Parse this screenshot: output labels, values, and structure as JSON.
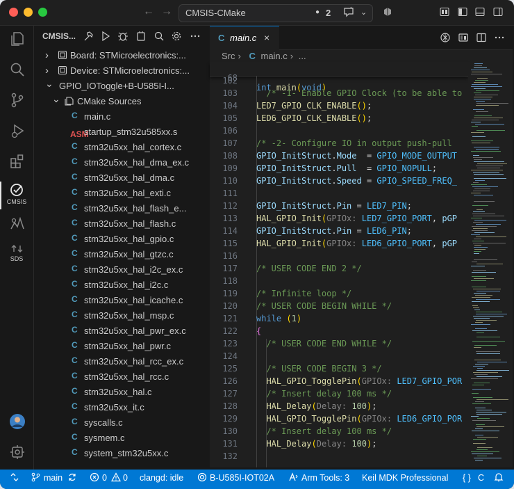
{
  "titlebar": {
    "command_center_title": "CMSIS-CMake",
    "changes_count": "2"
  },
  "activity_bar": {
    "items": [
      {
        "name": "explorer-icon"
      },
      {
        "name": "search-icon"
      },
      {
        "name": "source-control-icon"
      },
      {
        "name": "run-debug-icon"
      },
      {
        "name": "extensions-icon"
      },
      {
        "name": "cmsis-icon",
        "label": "CMSIS"
      },
      {
        "name": "arm-tools-icon"
      },
      {
        "name": "sds-icon",
        "label": "SDS"
      }
    ],
    "cmsis_label": "CMSIS",
    "sds_label": "SDS"
  },
  "sidebar": {
    "title": "CMSIS...",
    "tree": [
      {
        "label": "Board: STMicroelectronics:...",
        "icon": "board-icon",
        "expanded": false,
        "level": 0
      },
      {
        "label": "Device: STMicroelectronics:...",
        "icon": "device-icon",
        "expanded": false,
        "level": 0
      },
      {
        "label": "GPIO_IOToggle+B-U585I-I...",
        "icon": "project-icon",
        "expanded": true,
        "level": 0
      },
      {
        "label": "CMake Sources",
        "icon": "folder-icon",
        "expanded": true,
        "level": 1
      },
      {
        "label": "main.c",
        "icon": "c",
        "level": 2
      },
      {
        "label": "startup_stm32u585xx.s",
        "icon": "asm",
        "level": 2
      },
      {
        "label": "stm32u5xx_hal_cortex.c",
        "icon": "c",
        "level": 2
      },
      {
        "label": "stm32u5xx_hal_dma_ex.c",
        "icon": "c",
        "level": 2
      },
      {
        "label": "stm32u5xx_hal_dma.c",
        "icon": "c",
        "level": 2
      },
      {
        "label": "stm32u5xx_hal_exti.c",
        "icon": "c",
        "level": 2
      },
      {
        "label": "stm32u5xx_hal_flash_e...",
        "icon": "c",
        "level": 2
      },
      {
        "label": "stm32u5xx_hal_flash.c",
        "icon": "c",
        "level": 2
      },
      {
        "label": "stm32u5xx_hal_gpio.c",
        "icon": "c",
        "level": 2
      },
      {
        "label": "stm32u5xx_hal_gtzc.c",
        "icon": "c",
        "level": 2
      },
      {
        "label": "stm32u5xx_hal_i2c_ex.c",
        "icon": "c",
        "level": 2
      },
      {
        "label": "stm32u5xx_hal_i2c.c",
        "icon": "c",
        "level": 2
      },
      {
        "label": "stm32u5xx_hal_icache.c",
        "icon": "c",
        "level": 2
      },
      {
        "label": "stm32u5xx_hal_msp.c",
        "icon": "c",
        "level": 2
      },
      {
        "label": "stm32u5xx_hal_pwr_ex.c",
        "icon": "c",
        "level": 2
      },
      {
        "label": "stm32u5xx_hal_pwr.c",
        "icon": "c",
        "level": 2
      },
      {
        "label": "stm32u5xx_hal_rcc_ex.c",
        "icon": "c",
        "level": 2
      },
      {
        "label": "stm32u5xx_hal_rcc.c",
        "icon": "c",
        "level": 2
      },
      {
        "label": "stm32u5xx_hal.c",
        "icon": "c",
        "level": 2
      },
      {
        "label": "stm32u5xx_it.c",
        "icon": "c",
        "level": 2
      },
      {
        "label": "syscalls.c",
        "icon": "c",
        "level": 2
      },
      {
        "label": "sysmem.c",
        "icon": "c",
        "level": 2
      },
      {
        "label": "system_stm32u5xx.c",
        "icon": "c",
        "level": 2
      }
    ]
  },
  "editor": {
    "tab": {
      "icon": "C",
      "name": "main.c",
      "close": "×"
    },
    "breadcrumbs": {
      "folder": "Src",
      "file_icon": "C",
      "file": "main.c",
      "more": "..."
    },
    "sticky_line": {
      "number": "68",
      "text": "int main(void)"
    },
    "lines": [
      {
        "n": "102",
        "t": ""
      },
      {
        "n": "103",
        "t": "  /* -1- Enable GPIO Clock (to be able to"
      },
      {
        "n": "104",
        "t": "LED7_GPIO_CLK_ENABLE();"
      },
      {
        "n": "105",
        "t": "LED6_GPIO_CLK_ENABLE();"
      },
      {
        "n": "106",
        "t": ""
      },
      {
        "n": "107",
        "t": "/* -2- Configure IO in output push-pull"
      },
      {
        "n": "108",
        "t": "GPIO_InitStruct.Mode  = GPIO_MODE_OUTPUT"
      },
      {
        "n": "109",
        "t": "GPIO_InitStruct.Pull  = GPIO_NOPULL;"
      },
      {
        "n": "110",
        "t": "GPIO_InitStruct.Speed = GPIO_SPEED_FREQ_"
      },
      {
        "n": "111",
        "t": ""
      },
      {
        "n": "112",
        "t": "GPIO_InitStruct.Pin = LED7_PIN;"
      },
      {
        "n": "113",
        "t": "HAL_GPIO_Init(GPIOx: LED7_GPIO_PORT, pGP"
      },
      {
        "n": "114",
        "t": "GPIO_InitStruct.Pin = LED6_PIN;"
      },
      {
        "n": "115",
        "t": "HAL_GPIO_Init(GPIOx: LED6_GPIO_PORT, pGP"
      },
      {
        "n": "116",
        "t": ""
      },
      {
        "n": "117",
        "t": "/* USER CODE END 2 */"
      },
      {
        "n": "118",
        "t": ""
      },
      {
        "n": "119",
        "t": "/* Infinite loop */"
      },
      {
        "n": "120",
        "t": "/* USER CODE BEGIN WHILE */"
      },
      {
        "n": "121",
        "t": "while (1)"
      },
      {
        "n": "122",
        "t": "{"
      },
      {
        "n": "123",
        "t": "  /* USER CODE END WHILE */"
      },
      {
        "n": "124",
        "t": ""
      },
      {
        "n": "125",
        "t": "  /* USER CODE BEGIN 3 */"
      },
      {
        "n": "126",
        "t": "  HAL_GPIO_TogglePin(GPIOx: LED7_GPIO_POR"
      },
      {
        "n": "127",
        "t": "  /* Insert delay 100 ms */"
      },
      {
        "n": "128",
        "t": "  HAL_Delay(Delay: 100);"
      },
      {
        "n": "129",
        "t": "  HAL_GPIO_TogglePin(GPIOx: LED6_GPIO_POR"
      },
      {
        "n": "130",
        "t": "  /* Insert delay 100 ms */"
      },
      {
        "n": "131",
        "t": "  HAL_Delay(Delay: 100);"
      },
      {
        "n": "132",
        "t": ""
      }
    ]
  },
  "statusbar": {
    "branch": "main",
    "errors": "0",
    "warnings": "0",
    "clangd": "clangd: idle",
    "board": "B-U585I-IOT02A",
    "arm_tools": "Arm Tools: 3",
    "keil": "Keil MDK Professional",
    "language": "C"
  },
  "colors": {
    "accent": "#0078d4",
    "c_icon": "#519aba",
    "asm_icon": "#e05252"
  }
}
